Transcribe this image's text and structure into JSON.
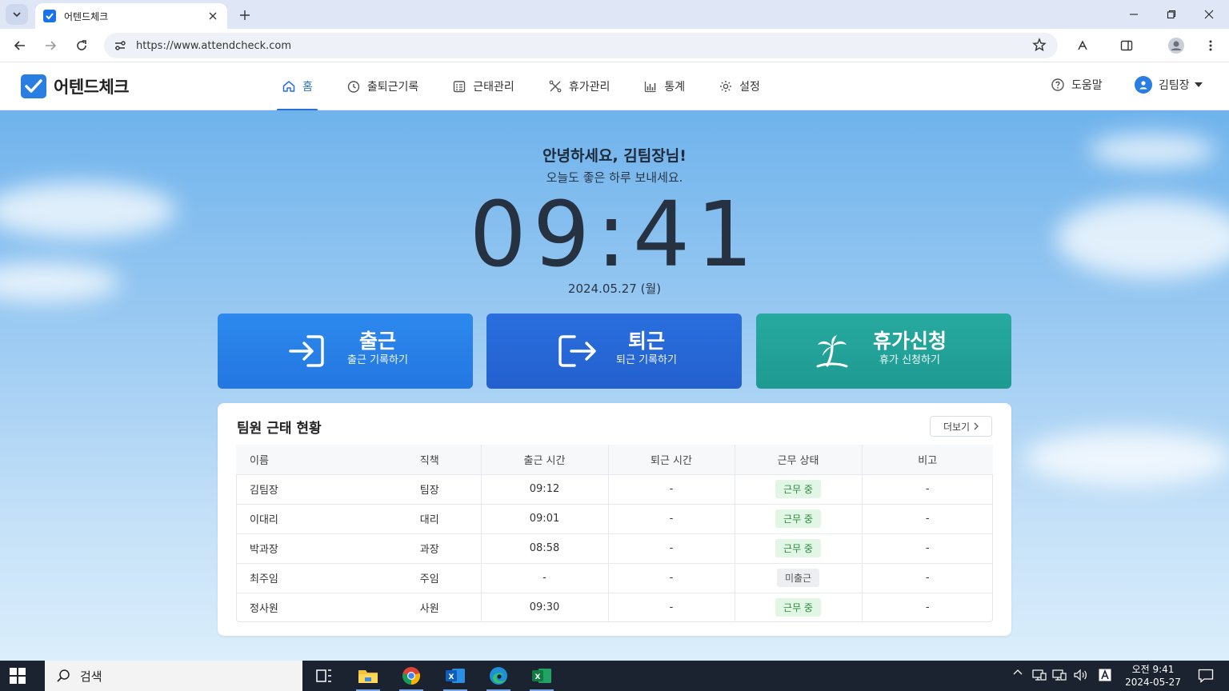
{
  "browser": {
    "tab_title": "어텐드체크",
    "url": "https://www.attendcheck.com"
  },
  "app": {
    "logo_text": "어텐드체크",
    "nav": [
      {
        "label": "홈",
        "icon": "home-icon",
        "active": true
      },
      {
        "label": "출퇴근기록",
        "icon": "clock-icon"
      },
      {
        "label": "근태관리",
        "icon": "calendar-list-icon"
      },
      {
        "label": "휴가관리",
        "icon": "tools-icon"
      },
      {
        "label": "통계",
        "icon": "bar-chart-icon"
      },
      {
        "label": "설정",
        "icon": "gear-icon"
      }
    ],
    "help_label": "도움말",
    "user_name": "김팀장"
  },
  "hero": {
    "greeting": "안녕하세요, 김팀장님!",
    "subtitle": "오늘도 좋은 하루 보내세요.",
    "time": "09:41",
    "date": "2024.05.27 (월)"
  },
  "actions": {
    "checkin": {
      "title": "출근",
      "sub": "출근 기록하기",
      "color": "#2a80e8"
    },
    "checkout": {
      "title": "퇴근",
      "sub": "퇴근 기록하기",
      "color": "#2566d6"
    },
    "leave": {
      "title": "휴가신청",
      "sub": "휴가 신청하기",
      "color": "#22a298"
    }
  },
  "team": {
    "title": "팀원 근태 현황",
    "more_label": "더보기",
    "columns": [
      "이름",
      "직책",
      "출근 시간",
      "퇴근 시간",
      "근무 상태",
      "비고"
    ],
    "rows": [
      {
        "name": "김팀장",
        "position": "팀장",
        "in": "09:12",
        "out": "-",
        "status": "근무 중",
        "status_type": "working",
        "note": "-"
      },
      {
        "name": "이대리",
        "position": "대리",
        "in": "09:01",
        "out": "-",
        "status": "근무 중",
        "status_type": "working",
        "note": "-"
      },
      {
        "name": "박과장",
        "position": "과장",
        "in": "08:58",
        "out": "-",
        "status": "근무 중",
        "status_type": "working",
        "note": "-"
      },
      {
        "name": "최주임",
        "position": "주임",
        "in": "-",
        "out": "-",
        "status": "미출근",
        "status_type": "absent",
        "note": "-"
      },
      {
        "name": "정사원",
        "position": "사원",
        "in": "09:30",
        "out": "-",
        "status": "근무 중",
        "status_type": "working",
        "note": "-"
      }
    ]
  },
  "taskbar": {
    "search_label": "검색",
    "time": "오전 9:41",
    "date": "2024-05-27"
  }
}
